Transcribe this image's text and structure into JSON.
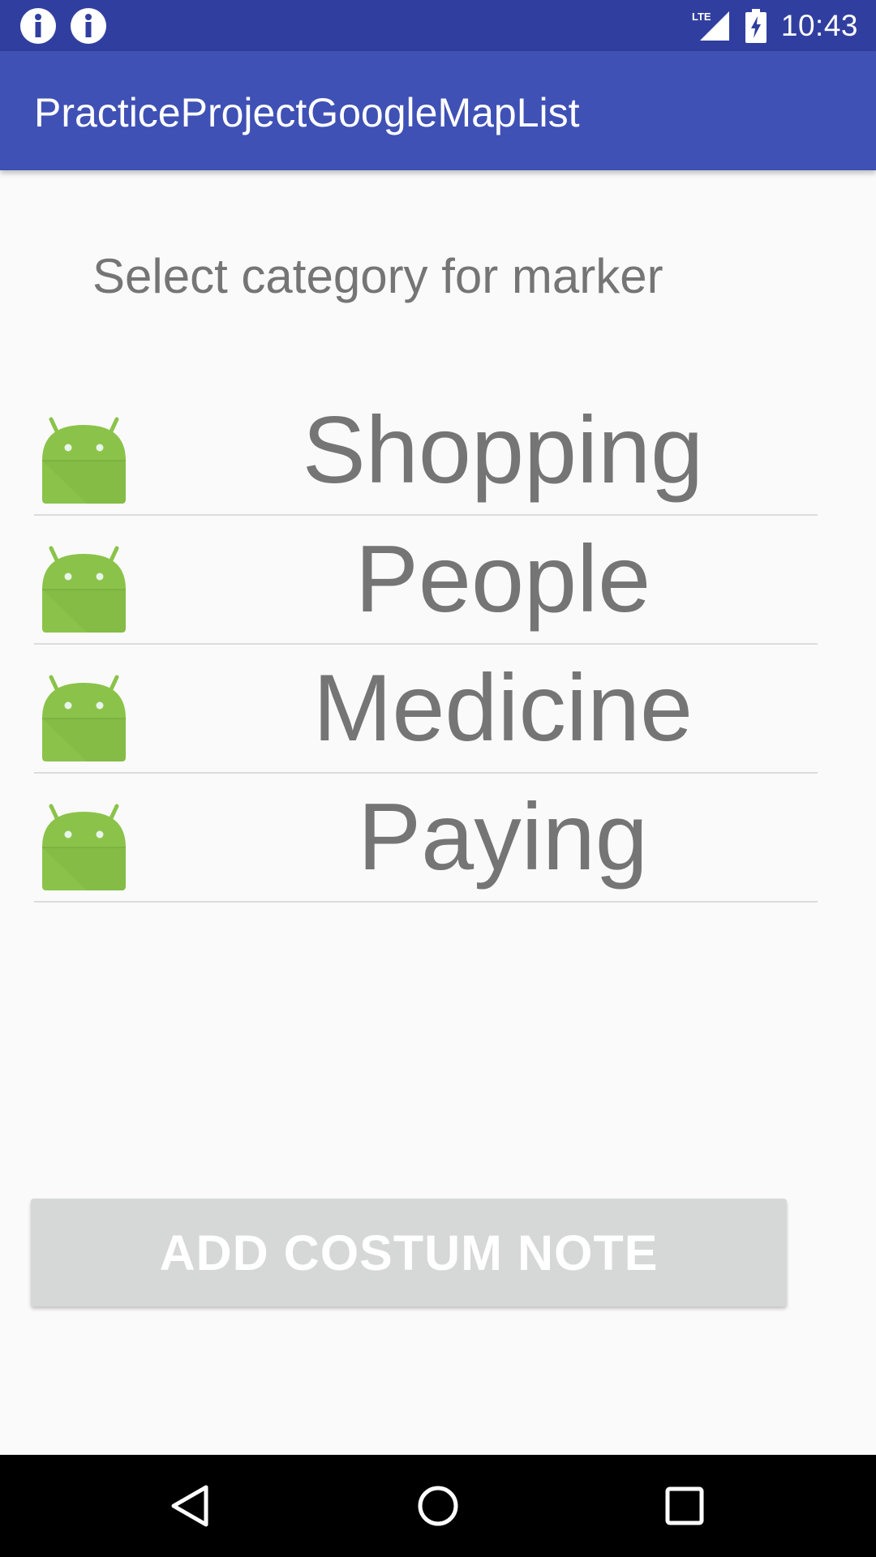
{
  "status_bar": {
    "time": "10:43",
    "notification_icons": [
      "info-icon",
      "info-icon"
    ],
    "network_label": "LTE",
    "icons": [
      "signal-icon",
      "battery-charging-icon"
    ]
  },
  "app_bar": {
    "title": "PracticeProjectGoogleMapList",
    "color": "#3f51b5",
    "status_color": "#303f9f"
  },
  "main": {
    "prompt": "Select category for marker",
    "categories": [
      {
        "label": "Shopping",
        "icon": "android-icon"
      },
      {
        "label": "People",
        "icon": "android-icon"
      },
      {
        "label": "Medicine",
        "icon": "android-icon"
      },
      {
        "label": "Paying",
        "icon": "android-icon"
      }
    ],
    "add_button_label": "ADD COSTUM NOTE"
  },
  "nav_bar": {
    "buttons": [
      "back-icon",
      "home-icon",
      "recents-icon"
    ]
  }
}
